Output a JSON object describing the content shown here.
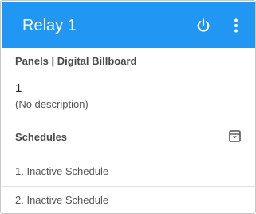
{
  "header": {
    "title": "Relay 1",
    "color": "#2196f3",
    "icons": [
      "power-icon",
      "more-vert-icon"
    ]
  },
  "subtitle": "Panels | Digital Billboard",
  "relay": {
    "number": "1",
    "description": "(No description)"
  },
  "schedules": {
    "title": "Schedules",
    "icon": "archive-icon",
    "items": [
      "1. Inactive Schedule",
      "2. Inactive Schedule"
    ]
  }
}
